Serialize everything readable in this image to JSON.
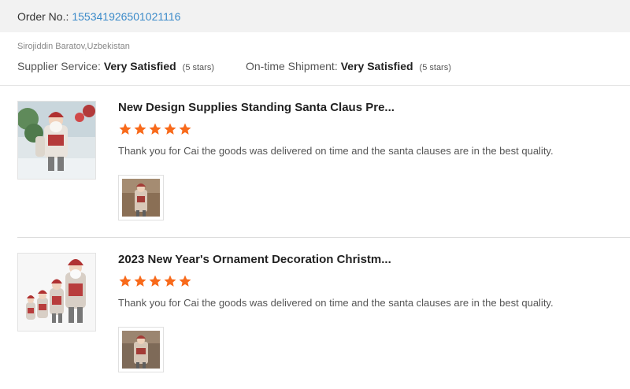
{
  "order": {
    "label": "Order No.:",
    "number": "155341926501021116"
  },
  "buyer": {
    "name_location": "Sirojiddin Baratov,Uzbekistan"
  },
  "ratings": {
    "supplier_label": "Supplier Service:",
    "supplier_value": "Very Satisfied",
    "supplier_stars": "(5 stars)",
    "shipment_label": "On-time Shipment:",
    "shipment_value": "Very Satisfied",
    "shipment_stars": "(5 stars)"
  },
  "colors": {
    "accent_link": "#3a8ac9",
    "star": "#f86a1b"
  },
  "reviews": [
    {
      "title": "New Design Supplies Standing Santa Claus Pre...",
      "rating": 5,
      "comment": "Thank you for Cai the goods was delivered on time and the santa clauses are in the best quality.",
      "thumb_icon": "santa-product-image",
      "photo_icon": "santa-photo"
    },
    {
      "title": "2023 New Year's Ornament Decoration Christm...",
      "rating": 5,
      "comment": "Thank you for Cai the goods was delivered on time and the santa clauses are in the best quality.",
      "thumb_icon": "santa-family-product-image",
      "photo_icon": "santa-photo"
    }
  ]
}
